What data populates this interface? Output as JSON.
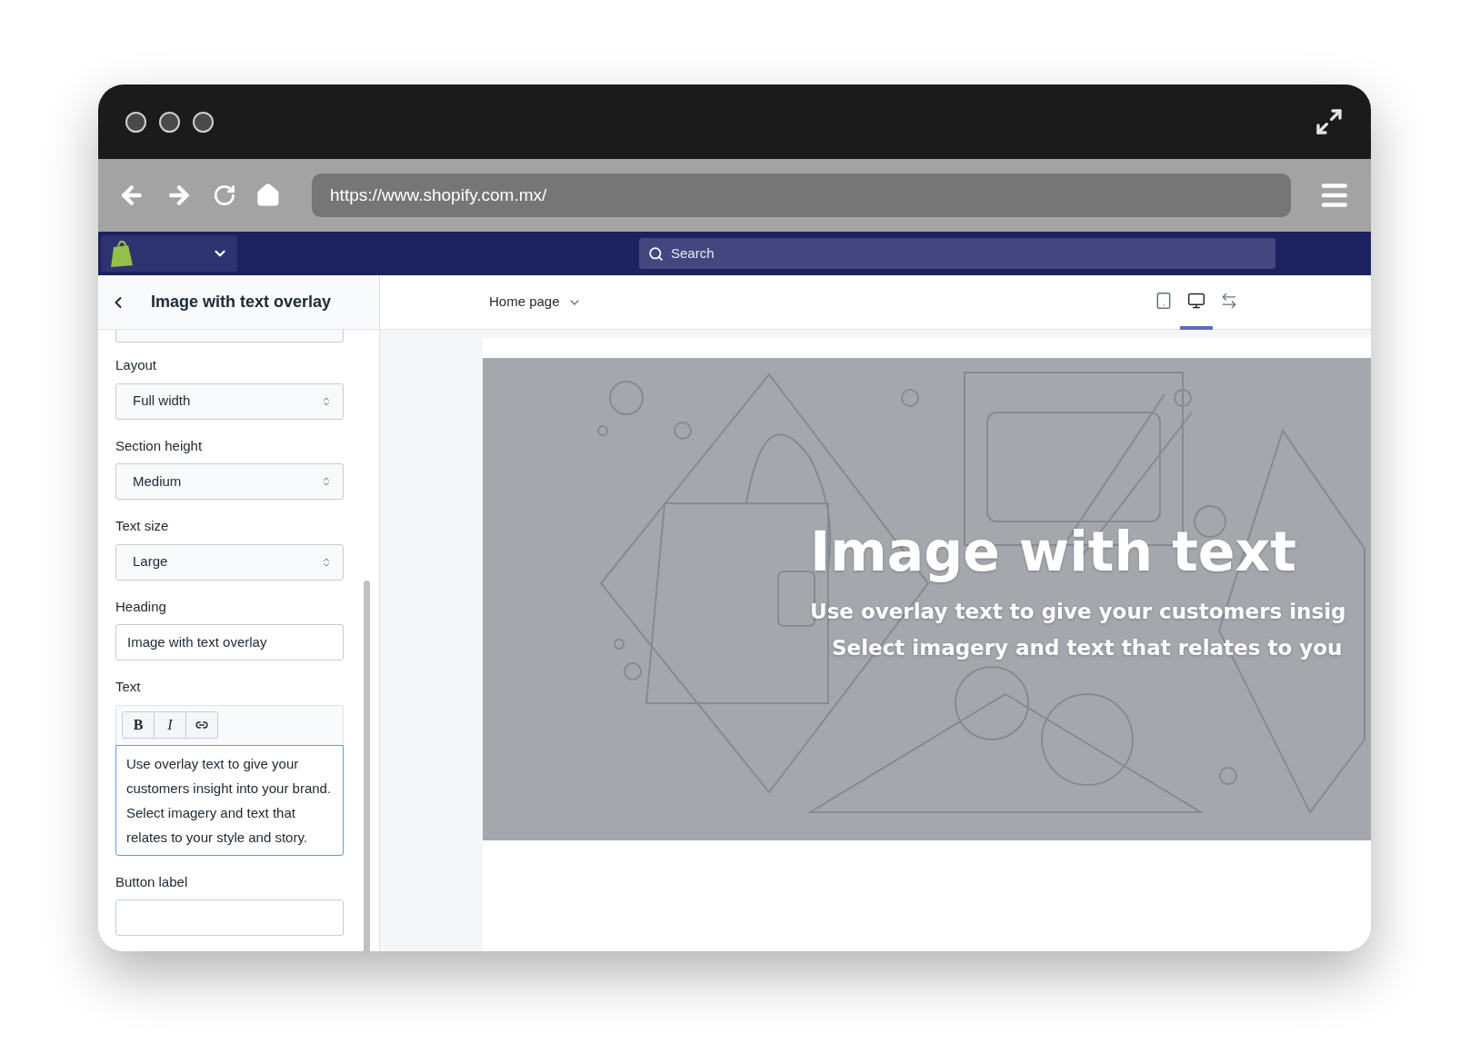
{
  "browser": {
    "url": "https://www.shopify.com.mx/"
  },
  "admin_bar": {
    "search": {
      "placeholder": "Search"
    }
  },
  "sidebar": {
    "title": "Image with text overlay",
    "fields": [
      {
        "kind": "select",
        "label": "Layout",
        "value": "Full width"
      },
      {
        "kind": "select",
        "label": "Section height",
        "value": "Medium"
      },
      {
        "kind": "select",
        "label": "Text size",
        "value": "Large"
      },
      {
        "kind": "text",
        "label": "Heading",
        "value": "Image with text overlay"
      },
      {
        "kind": "richtext",
        "label": "Text",
        "toolbar": [
          {
            "kind": "bold",
            "label": "B"
          },
          {
            "kind": "italic",
            "label": "I"
          },
          {
            "kind": "link"
          }
        ],
        "value": "Use overlay text to give your customers insight into your brand. Select imagery and text that relates to your style and story."
      },
      {
        "kind": "text",
        "label": "Button label"
      }
    ]
  },
  "preview": {
    "page_selector": "Home page",
    "devices": [
      {
        "kind": "mobile",
        "selected": false
      },
      {
        "kind": "desktop",
        "selected": true
      },
      {
        "kind": "fullscreen",
        "selected": false
      }
    ],
    "hero": {
      "heading": "Image with text",
      "text_lines": [
        "Use overlay text to give your customers insig",
        "Select imagery and text that relates to you"
      ]
    }
  }
}
